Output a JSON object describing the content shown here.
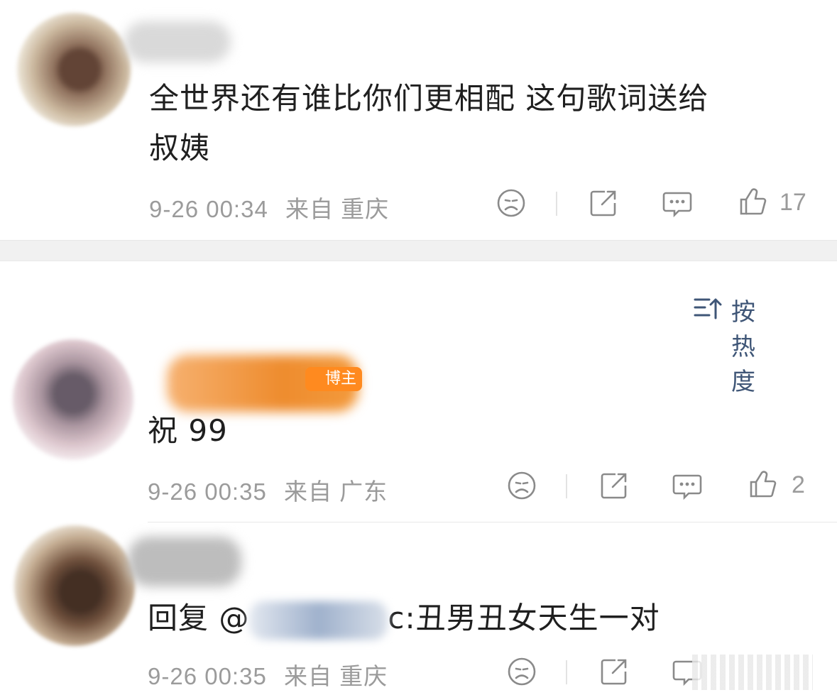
{
  "comments": [
    {
      "text_line1": "全世界还有谁比你们更相配 这句歌词送给",
      "text_line2": "叔姨",
      "time": "9-26 00:34",
      "source": "来自 重庆",
      "like_count": "17"
    },
    {
      "badge": "博主",
      "text": "祝 99",
      "time": "9-26 00:35",
      "source": "来自 广东",
      "like_count": "2"
    },
    {
      "reply_prefix": "回复 @",
      "reply_suffix": "c:丑男丑女天生一对",
      "time": "9-26 00:35",
      "source": "来自 重庆"
    }
  ],
  "sort": {
    "label": "按热度"
  },
  "icons": [
    "sad-face-icon",
    "share-icon",
    "comment-icon",
    "thumbs-up-icon",
    "sort-icon"
  ],
  "colors": {
    "meta": "#9b9b9b",
    "badge": "#ff8a1f",
    "sort": "#3f5677",
    "icon": "#8a8a8a"
  }
}
